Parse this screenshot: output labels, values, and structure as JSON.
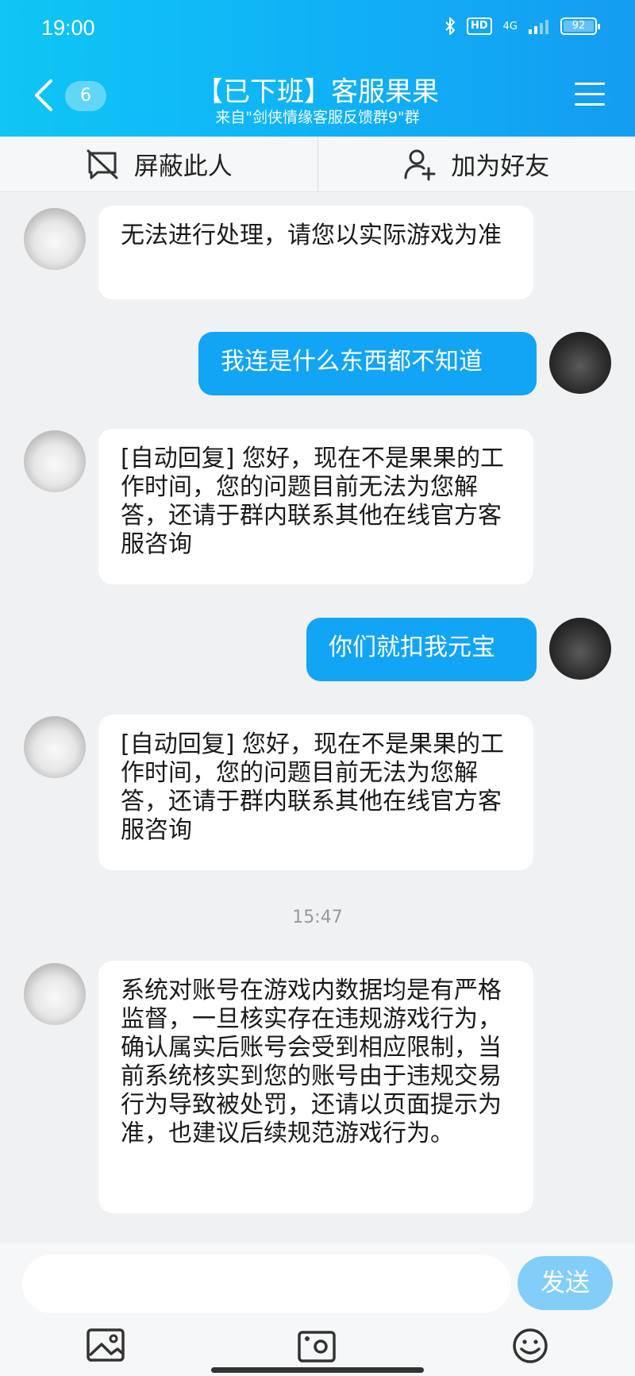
{
  "status_bar": {
    "time": "19:00",
    "bluetooth_icon": "bluetooth-icon",
    "hd_label": "HD",
    "network_label": "4G",
    "battery_level": "92"
  },
  "header": {
    "unread_count": "6",
    "title": "【已下班】客服果果",
    "subtitle": "来自\"剑侠情缘客服反馈群9\"群"
  },
  "actions": {
    "block_label": "屏蔽此人",
    "add_friend_label": "加为好友"
  },
  "messages": [
    {
      "side": "left",
      "text": "无法进行处理，请您以实际游戏为准"
    },
    {
      "side": "right",
      "text": "我连是什么东西都不知道"
    },
    {
      "side": "left",
      "text": "[自动回复] 您好，现在不是果果的工作时间，您的问题目前无法为您解答，还请于群内联系其他在线官方客服咨询"
    },
    {
      "side": "right",
      "text": "你们就扣我元宝"
    },
    {
      "side": "left",
      "text": "[自动回复] 您好，现在不是果果的工作时间，您的问题目前无法为您解答，还请于群内联系其他在线官方客服咨询"
    },
    {
      "side": "left",
      "text": "系统对账号在游戏内数据均是有严格监督，一旦核实存在违规游戏行为，确认属实后账号会受到相应限制，当前系统核实到您的账号由于违规交易行为导致被处罚，还请以页面提示为准，也建议后续规范游戏行为。"
    }
  ],
  "time_label": "15:47",
  "input": {
    "value": "",
    "send_label": "发送"
  },
  "colors": {
    "header_start": "#0fc6f5",
    "header_end": "#149df2",
    "bubble_self": "#12a4f5",
    "send_button": "#83cef8"
  }
}
